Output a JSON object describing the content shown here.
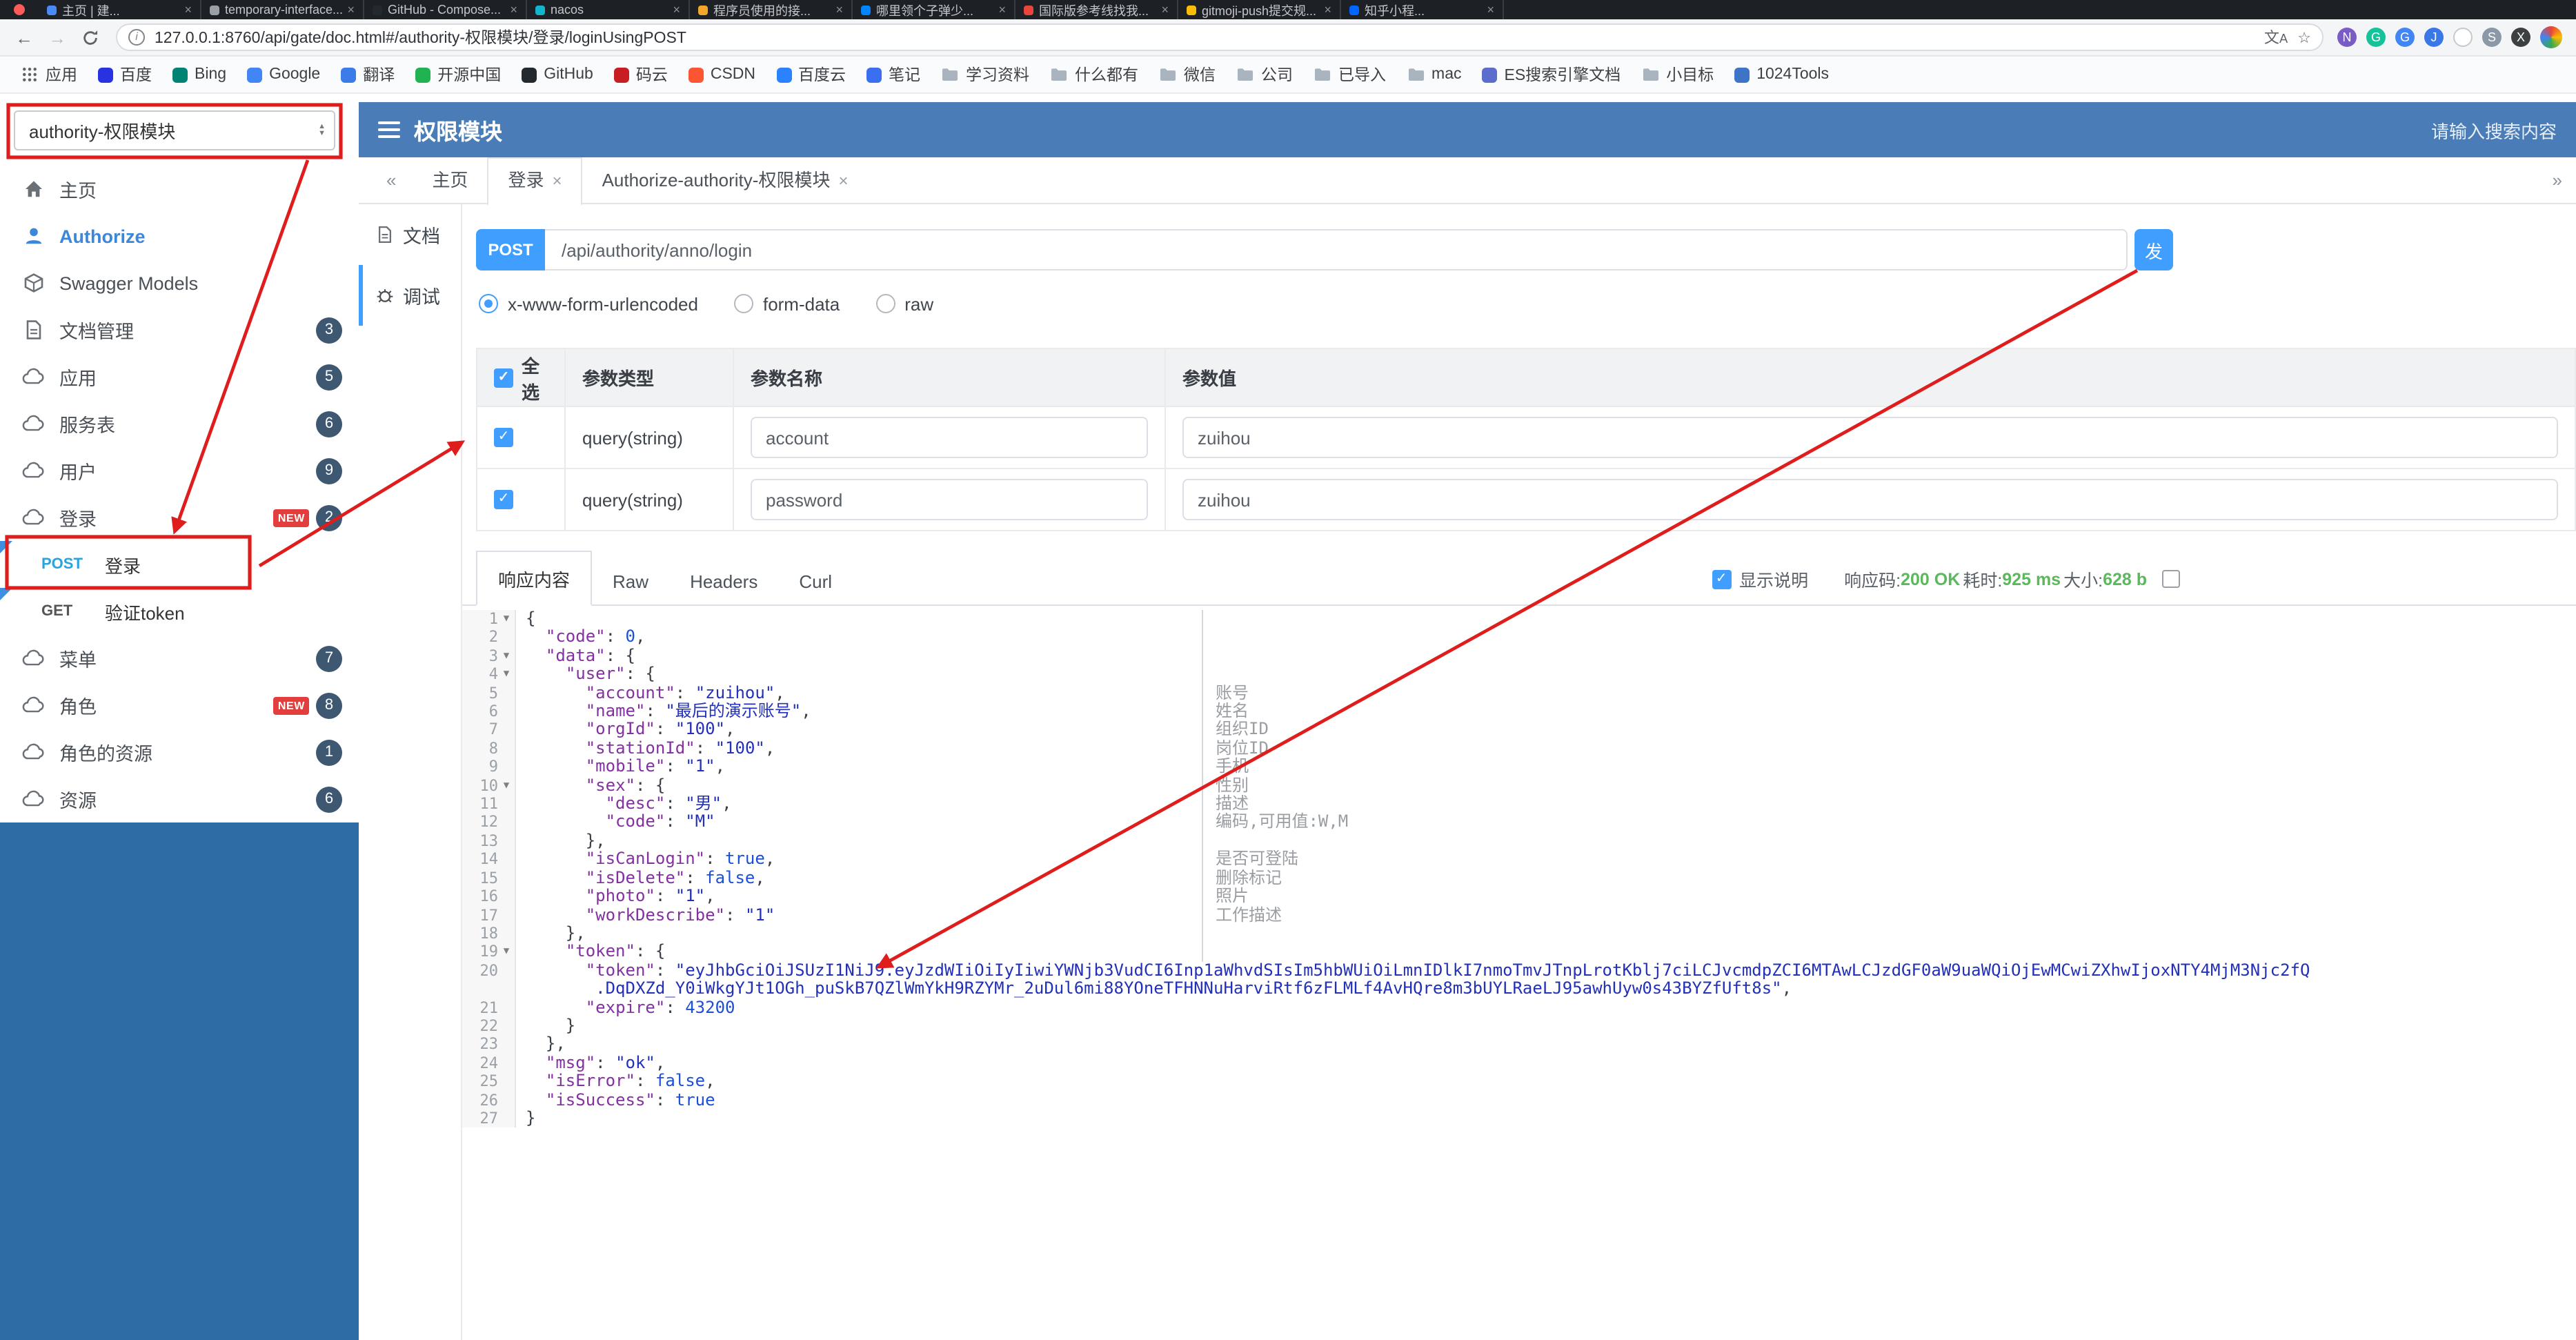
{
  "annotation_color": "#e01d1d",
  "browser": {
    "tabs": [
      {
        "title": "主页 | 建...",
        "color": "#4a8af4"
      },
      {
        "title": "temporary-interface...",
        "color": "#9aa0a6"
      },
      {
        "title": "GitHub - Compose...",
        "color": "#24292e"
      },
      {
        "title": "nacos",
        "color": "#12b5cb"
      },
      {
        "title": "程序员使用的接...",
        "color": "#f4a62a"
      },
      {
        "title": "哪里领个子弹少...",
        "color": "#0084ff"
      },
      {
        "title": "国际版参考线找我...",
        "color": "#e8453c"
      },
      {
        "title": "gitmoji-push提交规...",
        "color": "#fbbc05"
      },
      {
        "title": "知乎小程...",
        "color": "#0066ff"
      }
    ],
    "url": "127.0.0.1:8760/api/gate/doc.html#/authority-权限模块/登录/loginUsingPOST",
    "toolbar_icons": [
      {
        "name": "onenote-extension-icon",
        "color": "#7a5cc5",
        "glyph": "N"
      },
      {
        "name": "grammarly-extension-icon",
        "color": "#15c39a",
        "glyph": "G"
      },
      {
        "name": "google-account-icon",
        "color": "#4285f4",
        "glyph": "G"
      },
      {
        "name": "json-viewer-extension-icon",
        "color": "#3b78e7",
        "glyph": "J"
      },
      {
        "name": "circle-extension-icon",
        "color": "#ffffff",
        "glyph": ""
      },
      {
        "name": "shield-extension-icon",
        "color": "#8a98a8",
        "glyph": "S"
      },
      {
        "name": "pinned-extension-icon",
        "color": "#3c4043",
        "glyph": "X"
      }
    ],
    "bookmarks": [
      {
        "label": "应用",
        "icon": "apps"
      },
      {
        "label": "百度",
        "icon": "site",
        "color": "#2932e1"
      },
      {
        "label": "Bing",
        "icon": "site",
        "color": "#008373"
      },
      {
        "label": "Google",
        "icon": "site",
        "color": "#4285f4"
      },
      {
        "label": "翻译",
        "icon": "site",
        "color": "#3b7ce9"
      },
      {
        "label": "开源中国",
        "icon": "site",
        "color": "#21b351"
      },
      {
        "label": "GitHub",
        "icon": "site",
        "color": "#24292e"
      },
      {
        "label": "码云",
        "icon": "site",
        "color": "#c71d23"
      },
      {
        "label": "CSDN",
        "icon": "site",
        "color": "#fc5531"
      },
      {
        "label": "百度云",
        "icon": "site",
        "color": "#2b82ff"
      },
      {
        "label": "笔记",
        "icon": "site",
        "color": "#3a6ff0"
      },
      {
        "label": "学习资料",
        "icon": "folder"
      },
      {
        "label": "什么都有",
        "icon": "folder"
      },
      {
        "label": "微信",
        "icon": "folder"
      },
      {
        "label": "公司",
        "icon": "folder"
      },
      {
        "label": "已导入",
        "icon": "folder"
      },
      {
        "label": "mac",
        "icon": "folder"
      },
      {
        "label": "ES搜索引擎文档",
        "icon": "site",
        "color": "#5b6dcd"
      },
      {
        "label": "小目标",
        "icon": "folder"
      },
      {
        "label": "1024Tools",
        "icon": "site",
        "color": "#3e74c6"
      }
    ]
  },
  "header": {
    "module_select": "authority-权限模块",
    "title": "权限模块",
    "search_placeholder": "请输入搜索内容"
  },
  "sidebar": {
    "items": [
      {
        "kind": "item",
        "label": "主页",
        "icon": "home-icon"
      },
      {
        "kind": "item",
        "label": "Authorize",
        "icon": "auth-icon",
        "accent": true
      },
      {
        "kind": "item",
        "label": "Swagger Models",
        "icon": "models-icon"
      },
      {
        "kind": "item",
        "label": "文档管理",
        "icon": "doc-icon",
        "badge": "3"
      },
      {
        "kind": "item",
        "label": "应用",
        "icon": "cloud-icon",
        "badge": "5"
      },
      {
        "kind": "item",
        "label": "服务表",
        "icon": "cloud-icon",
        "badge": "6"
      },
      {
        "kind": "item",
        "label": "用户",
        "icon": "cloud-icon",
        "badge": "9"
      },
      {
        "kind": "item",
        "label": "登录",
        "icon": "cloud-icon",
        "badge": "2",
        "new": "NEW"
      },
      {
        "kind": "endpoint",
        "method": "POST",
        "label": "登录",
        "selected": true
      },
      {
        "kind": "endpoint",
        "method": "GET",
        "label": "验证token"
      },
      {
        "kind": "item",
        "label": "菜单",
        "icon": "cloud-icon",
        "badge": "7"
      },
      {
        "kind": "item",
        "label": "角色",
        "icon": "cloud-icon",
        "badge": "8",
        "new": "NEW"
      },
      {
        "kind": "item",
        "label": "角色的资源",
        "icon": "cloud-icon",
        "badge": "1"
      },
      {
        "kind": "item",
        "label": "资源",
        "icon": "cloud-icon",
        "badge": "6"
      }
    ]
  },
  "content_tabs": {
    "collapse": "«",
    "expand": "»",
    "tabs": [
      {
        "label": "主页",
        "closable": false
      },
      {
        "label": "登录",
        "closable": true,
        "active": true
      },
      {
        "label": "Authorize-authority-权限模块",
        "closable": true
      }
    ]
  },
  "doc_nav": [
    {
      "label": "文档",
      "icon": "doc-icon"
    },
    {
      "label": "调试",
      "icon": "debug-icon",
      "active": true
    }
  ],
  "request": {
    "method": "POST",
    "url": "/api/authority/anno/login",
    "send_label": "发",
    "content_types": [
      {
        "label": "x-www-form-urlencoded",
        "selected": true
      },
      {
        "label": "form-data",
        "selected": false
      },
      {
        "label": "raw",
        "selected": false
      }
    ],
    "params_table": {
      "headers": {
        "select_all": "全选",
        "type": "参数类型",
        "name": "参数名称",
        "value": "参数值"
      },
      "rows": [
        {
          "checked": true,
          "type": "query(string)",
          "name": "account",
          "value": "zuihou"
        },
        {
          "checked": true,
          "type": "query(string)",
          "name": "password",
          "value": "zuihou"
        }
      ]
    }
  },
  "response": {
    "tabs": [
      {
        "label": "响应内容",
        "active": true
      },
      {
        "label": "Raw"
      },
      {
        "label": "Headers"
      },
      {
        "label": "Curl"
      }
    ],
    "show_description": "显示说明",
    "meta": [
      {
        "label": "响应码:",
        "value": "200 OK"
      },
      {
        "label": "耗时:",
        "value": "925 ms"
      },
      {
        "label": "大小:",
        "value": "628 b"
      }
    ]
  },
  "code": {
    "lines": [
      {
        "n": "1",
        "fold": true,
        "cell": true,
        "seg": [
          [
            "pl",
            "{"
          ]
        ]
      },
      {
        "n": "2",
        "cell": true,
        "seg": [
          [
            "pl",
            "  "
          ],
          [
            "key",
            "\"code\""
          ],
          [
            "pl",
            ": "
          ],
          [
            "num",
            "0"
          ],
          [
            "pl",
            ","
          ]
        ]
      },
      {
        "n": "3",
        "fold": true,
        "cell": true,
        "seg": [
          [
            "pl",
            "  "
          ],
          [
            "key",
            "\"data\""
          ],
          [
            "pl",
            ": {"
          ]
        ]
      },
      {
        "n": "4",
        "fold": true,
        "cell": true,
        "seg": [
          [
            "pl",
            "    "
          ],
          [
            "key",
            "\"user\""
          ],
          [
            "pl",
            ": {"
          ]
        ]
      },
      {
        "n": "5",
        "cell": true,
        "note": "账号",
        "seg": [
          [
            "pl",
            "      "
          ],
          [
            "key",
            "\"account\""
          ],
          [
            "pl",
            ": "
          ],
          [
            "str",
            "\"zuihou\""
          ],
          [
            "pl",
            ","
          ]
        ]
      },
      {
        "n": "6",
        "cell": true,
        "note": "姓名",
        "seg": [
          [
            "pl",
            "      "
          ],
          [
            "key",
            "\"name\""
          ],
          [
            "pl",
            ": "
          ],
          [
            "str",
            "\"最后的演示账号\""
          ],
          [
            "pl",
            ","
          ]
        ]
      },
      {
        "n": "7",
        "cell": true,
        "note": "组织ID",
        "seg": [
          [
            "pl",
            "      "
          ],
          [
            "key",
            "\"orgId\""
          ],
          [
            "pl",
            ": "
          ],
          [
            "str",
            "\"100\""
          ],
          [
            "pl",
            ","
          ]
        ]
      },
      {
        "n": "8",
        "cell": true,
        "note": "岗位ID",
        "seg": [
          [
            "pl",
            "      "
          ],
          [
            "key",
            "\"stationId\""
          ],
          [
            "pl",
            ": "
          ],
          [
            "str",
            "\"100\""
          ],
          [
            "pl",
            ","
          ]
        ]
      },
      {
        "n": "9",
        "cell": true,
        "note": "手机",
        "seg": [
          [
            "pl",
            "      "
          ],
          [
            "key",
            "\"mobile\""
          ],
          [
            "pl",
            ": "
          ],
          [
            "str",
            "\"1\""
          ],
          [
            "pl",
            ","
          ]
        ]
      },
      {
        "n": "10",
        "fold": true,
        "cell": true,
        "note": "性别",
        "seg": [
          [
            "pl",
            "      "
          ],
          [
            "key",
            "\"sex\""
          ],
          [
            "pl",
            ": {"
          ]
        ]
      },
      {
        "n": "11",
        "cell": true,
        "note": "描述",
        "seg": [
          [
            "pl",
            "        "
          ],
          [
            "key",
            "\"desc\""
          ],
          [
            "pl",
            ": "
          ],
          [
            "str",
            "\"男\""
          ],
          [
            "pl",
            ","
          ]
        ]
      },
      {
        "n": "12",
        "cell": true,
        "note": "编码,可用值:W,M",
        "seg": [
          [
            "pl",
            "        "
          ],
          [
            "key",
            "\"code\""
          ],
          [
            "pl",
            ": "
          ],
          [
            "str",
            "\"M\""
          ]
        ]
      },
      {
        "n": "13",
        "cell": true,
        "seg": [
          [
            "pl",
            "      },"
          ]
        ]
      },
      {
        "n": "14",
        "cell": true,
        "note": "是否可登陆",
        "seg": [
          [
            "pl",
            "      "
          ],
          [
            "key",
            "\"isCanLogin\""
          ],
          [
            "pl",
            ": "
          ],
          [
            "bool",
            "true"
          ],
          [
            "pl",
            ","
          ]
        ]
      },
      {
        "n": "15",
        "cell": true,
        "note": "删除标记",
        "seg": [
          [
            "pl",
            "      "
          ],
          [
            "key",
            "\"isDelete\""
          ],
          [
            "pl",
            ": "
          ],
          [
            "bool",
            "false"
          ],
          [
            "pl",
            ","
          ]
        ]
      },
      {
        "n": "16",
        "cell": true,
        "note": "照片",
        "seg": [
          [
            "pl",
            "      "
          ],
          [
            "key",
            "\"photo\""
          ],
          [
            "pl",
            ": "
          ],
          [
            "str",
            "\"1\""
          ],
          [
            "pl",
            ","
          ]
        ]
      },
      {
        "n": "17",
        "cell": true,
        "note": "工作描述",
        "seg": [
          [
            "pl",
            "      "
          ],
          [
            "key",
            "\"workDescribe\""
          ],
          [
            "pl",
            ": "
          ],
          [
            "str",
            "\"1\""
          ]
        ]
      },
      {
        "n": "18",
        "cell": true,
        "seg": [
          [
            "pl",
            "    },"
          ]
        ]
      },
      {
        "n": "19",
        "fold": true,
        "cell": true,
        "seg": [
          [
            "pl",
            "    "
          ],
          [
            "key",
            "\"token\""
          ],
          [
            "pl",
            ": {"
          ]
        ]
      },
      {
        "n": "20",
        "seg": [
          [
            "pl",
            "      "
          ],
          [
            "key",
            "\"token\""
          ],
          [
            "pl",
            ": "
          ],
          [
            "str",
            "\"eyJhbGciOiJSUzI1NiJ9.eyJzdWIiOiIyIiwiYWNjb3VudCI6Inp1aWhvdSIsIm5hbWUiOiLmnIDlkI7nmoTmvJTnpLrotKblj7ciLCJvcmdpZCI6MTAwLCJzdGF0aW9uaWQiOjEwMCwiZXhwIjoxNTY4MjM3Njc2fQ"
          ]
        ]
      },
      {
        "n": "",
        "seg": [
          [
            "str",
            "       .DqDXZd_Y0iWkgYJt1OGh_puSkB7QZlWmYkH9RZYMr_2uDul6mi88YOneTFHNNuHarviRtf6zFLMLf4AvHQre8m3bUYLRaeLJ95awhUyw0s43BYZfUft8s\""
          ],
          [
            "pl",
            ","
          ]
        ]
      },
      {
        "n": "21",
        "seg": [
          [
            "pl",
            "      "
          ],
          [
            "key",
            "\"expire\""
          ],
          [
            "pl",
            ": "
          ],
          [
            "num",
            "43200"
          ]
        ]
      },
      {
        "n": "22",
        "seg": [
          [
            "pl",
            "    }"
          ]
        ]
      },
      {
        "n": "23",
        "seg": [
          [
            "pl",
            "  },"
          ]
        ]
      },
      {
        "n": "24",
        "seg": [
          [
            "pl",
            "  "
          ],
          [
            "key",
            "\"msg\""
          ],
          [
            "pl",
            ": "
          ],
          [
            "str",
            "\"ok\""
          ],
          [
            "pl",
            ","
          ]
        ]
      },
      {
        "n": "25",
        "seg": [
          [
            "pl",
            "  "
          ],
          [
            "key",
            "\"isError\""
          ],
          [
            "pl",
            ": "
          ],
          [
            "bool",
            "false"
          ],
          [
            "pl",
            ","
          ]
        ]
      },
      {
        "n": "26",
        "seg": [
          [
            "pl",
            "  "
          ],
          [
            "key",
            "\"isSuccess\""
          ],
          [
            "pl",
            ": "
          ],
          [
            "bool",
            "true"
          ]
        ]
      },
      {
        "n": "27",
        "seg": [
          [
            "pl",
            "}"
          ]
        ]
      }
    ]
  }
}
